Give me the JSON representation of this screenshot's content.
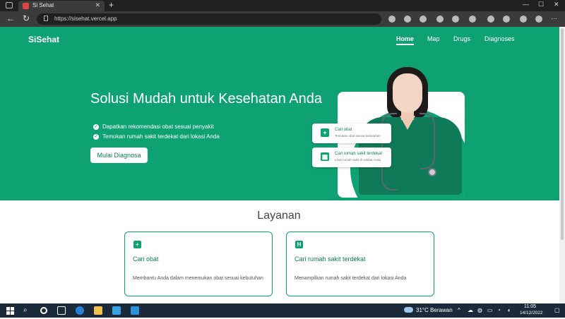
{
  "browser": {
    "tab_title": "Si Sehat",
    "tab_close": "✕",
    "new_tab": "+",
    "url": "https://sisehat.vercel.app",
    "window_min": "—",
    "window_max": "☐",
    "window_close": "✕",
    "back": "←",
    "refresh": "↻"
  },
  "header": {
    "brand": "SiSehat",
    "nav": [
      {
        "label": "Home"
      },
      {
        "label": "Map"
      },
      {
        "label": "Drugs"
      },
      {
        "label": "Diagnoses"
      }
    ]
  },
  "hero": {
    "title": "Solusi Mudah untuk Kesehatan Anda",
    "features": [
      "Dapatkan rekomendasi obat sesuai penyakit",
      "Temukan rumah sakit terdekat dari lokasi Anda"
    ],
    "cta_label": "Mulai Diagnosa",
    "cards": [
      {
        "title": "Cari obat",
        "subtitle": "Temukan obat sesuai kebutuhan"
      },
      {
        "title": "Cari rumah sakit terdekat",
        "subtitle": "Lihat rumah sakit di sekitar Anda"
      }
    ]
  },
  "services": {
    "title": "Layanan",
    "items": [
      {
        "title": "Cari obat",
        "description": "Membantu Anda dalam menemukan obat sesuai kebutuhan"
      },
      {
        "title": "Cari rumah sakit terdekat",
        "description": "Menampilkan rumah sakit terdekat dari lokasi Anda"
      }
    ]
  },
  "taskbar": {
    "weather": "31°C  Berawan",
    "time": "11:05",
    "date": "14/12/2022"
  },
  "colors": {
    "primary": "#0ea172",
    "primary_dark": "#0a7e5a",
    "taskbar": "#1b2a3a"
  },
  "icons": {
    "feature_check": "check-circle-icon",
    "card_drug": "medical-kit-icon",
    "card_hospital": "hospital-icon"
  }
}
